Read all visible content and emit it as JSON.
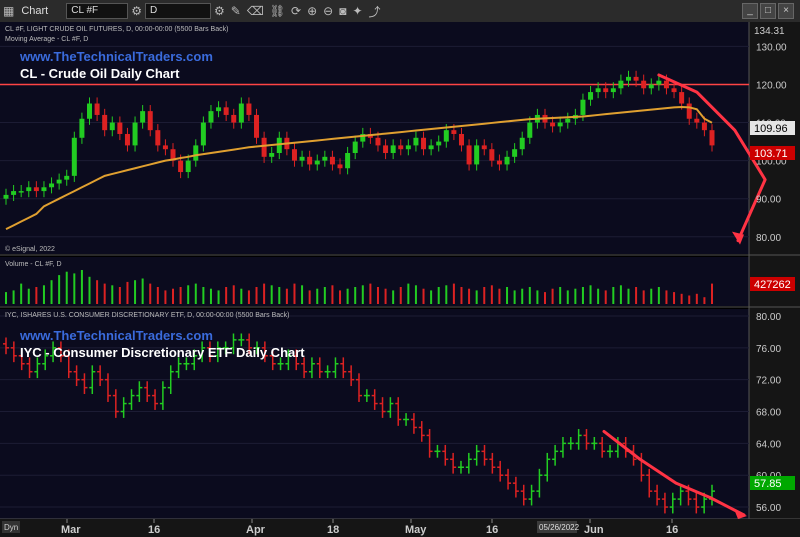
{
  "toolbar": {
    "app": "Chart",
    "symbol": "CL #F",
    "interval": "D",
    "link_badge": "Dyn"
  },
  "chart_data": [
    {
      "type": "candlestick",
      "panel": "price",
      "info_line": "CL #F, LIGHT CRUDE OIL FUTURES, D, 00:00-00:00 (5500 Bars Back)",
      "study_line": "Moving Average - CL #F, D",
      "watermark_site": "www.TheTechnicalTraders.com",
      "title": "CL - Crude Oil Daily Chart",
      "copyright": "© eSignal, 2022",
      "ylim": [
        76,
        134.31
      ],
      "yticks": [
        80,
        90,
        100,
        110,
        120,
        130
      ],
      "top_label": "134.31",
      "last_price": "103.71",
      "ma_value": "109.96",
      "resistance_level": 120,
      "closes": [
        91,
        92,
        92,
        93,
        92,
        93,
        94,
        95,
        96,
        106,
        111,
        115,
        112,
        108,
        110,
        107,
        104,
        110,
        113,
        108,
        104,
        103,
        100,
        97,
        100,
        104,
        110,
        113,
        114,
        112,
        110,
        115,
        112,
        106,
        101,
        102,
        106,
        103,
        100,
        101,
        99,
        100,
        101,
        99,
        98,
        102,
        105,
        107,
        106,
        104,
        102,
        104,
        103,
        104,
        106,
        103,
        104,
        105,
        108,
        107,
        104,
        99,
        104,
        103,
        100,
        99,
        101,
        103,
        106,
        110,
        112,
        110,
        109,
        110,
        111,
        112,
        116,
        118,
        119,
        118,
        119,
        121,
        122,
        121,
        119,
        120,
        121,
        119,
        118,
        115,
        111,
        110,
        108,
        104
      ],
      "moving_average": [
        82,
        83,
        84,
        85,
        86,
        88,
        89,
        90,
        91,
        92,
        93,
        94,
        95,
        96,
        96.5,
        97,
        97.5,
        98,
        98.5,
        99,
        99.5,
        100,
        100.3,
        100.7,
        101,
        101.4,
        101.7,
        102,
        102.3,
        102.6,
        102.9,
        103.2,
        103.5,
        103.7,
        103.9,
        104.1,
        104.3,
        104.5,
        104.7,
        104.9,
        105.1,
        105.3,
        105.5,
        105.7,
        105.9,
        106.1,
        106.3,
        106.5,
        106.7,
        106.9,
        107.1,
        107.3,
        107.5,
        107.7,
        107.9,
        108.1,
        108.3,
        108.5,
        108.7,
        108.9,
        109.1,
        109.3,
        109.5,
        109.7,
        109.9,
        110.1,
        110.3,
        110.5,
        110.7,
        110.9,
        111,
        111.1,
        111.2,
        111.3,
        111.4,
        111.5,
        111.6,
        111.8,
        112,
        112.2,
        112.4,
        112.6,
        112.8,
        113,
        113.2,
        113.4,
        113.6,
        113.8,
        114,
        114.1,
        114,
        113.5,
        111,
        109.96
      ]
    },
    {
      "type": "bar",
      "panel": "volume",
      "info_line": "Volume - CL #F, D",
      "last_value": "427262",
      "volumes": [
        0.35,
        0.4,
        0.6,
        0.45,
        0.5,
        0.55,
        0.7,
        0.85,
        0.95,
        0.9,
        1,
        0.8,
        0.7,
        0.6,
        0.55,
        0.5,
        0.65,
        0.7,
        0.75,
        0.6,
        0.5,
        0.4,
        0.45,
        0.5,
        0.55,
        0.6,
        0.5,
        0.45,
        0.4,
        0.5,
        0.55,
        0.45,
        0.4,
        0.5,
        0.6,
        0.55,
        0.5,
        0.45,
        0.6,
        0.55,
        0.4,
        0.45,
        0.5,
        0.55,
        0.4,
        0.45,
        0.5,
        0.55,
        0.6,
        0.5,
        0.45,
        0.4,
        0.5,
        0.6,
        0.55,
        0.45,
        0.4,
        0.5,
        0.55,
        0.6,
        0.5,
        0.45,
        0.4,
        0.5,
        0.55,
        0.45,
        0.5,
        0.4,
        0.45,
        0.5,
        0.4,
        0.35,
        0.45,
        0.5,
        0.4,
        0.45,
        0.5,
        0.55,
        0.45,
        0.4,
        0.5,
        0.55,
        0.45,
        0.5,
        0.4,
        0.45,
        0.5,
        0.4,
        0.35,
        0.3,
        0.25,
        0.3,
        0.2,
        0.6
      ]
    },
    {
      "type": "ohlc",
      "panel": "iyc",
      "info_line": "IYC, ISHARES U.S. CONSUMER DISCRETIONARY ETF, D, 00:00-00:00 (5500 Bars Back)",
      "watermark_site": "www.TheTechnicalTraders.com",
      "title": "IYC - Consumer Discretionary ETF Daily Chart",
      "ylim": [
        54.5,
        80.5
      ],
      "yticks": [
        56,
        60,
        64,
        68,
        72,
        76,
        80
      ],
      "last_price": "57.85",
      "closes": [
        76,
        75,
        74,
        73,
        74,
        75,
        76,
        75,
        73,
        72,
        71,
        73,
        72,
        70,
        68,
        69,
        70,
        71,
        70,
        69,
        71,
        73,
        74,
        74,
        75,
        76,
        75,
        76,
        76,
        77,
        77,
        76,
        76,
        75,
        74,
        74,
        75,
        74,
        73,
        74,
        73,
        73,
        74,
        73,
        72,
        70,
        70,
        69,
        68,
        69,
        67,
        67,
        66,
        65,
        63,
        63,
        62,
        61,
        61,
        62,
        63,
        62,
        61,
        60,
        59,
        58,
        57,
        58,
        60,
        62,
        63,
        64,
        64,
        65,
        64,
        64,
        63,
        63,
        64,
        63,
        62,
        60,
        58,
        57,
        56,
        57,
        58,
        57,
        56,
        57,
        58
      ]
    }
  ],
  "x_axis": {
    "labels": [
      "Mar",
      "16",
      "Apr",
      "18",
      "May",
      "16",
      "Jun",
      "16"
    ],
    "cursor_date": "05/26/2022"
  },
  "colors": {
    "up": "#22cc22",
    "down": "#dd2222",
    "moving_average": "#e0a030",
    "resistance": "#ff4444",
    "arrow": "#ff3344",
    "site_text": "#3a6bdc",
    "price_tag": "#cc0000"
  }
}
